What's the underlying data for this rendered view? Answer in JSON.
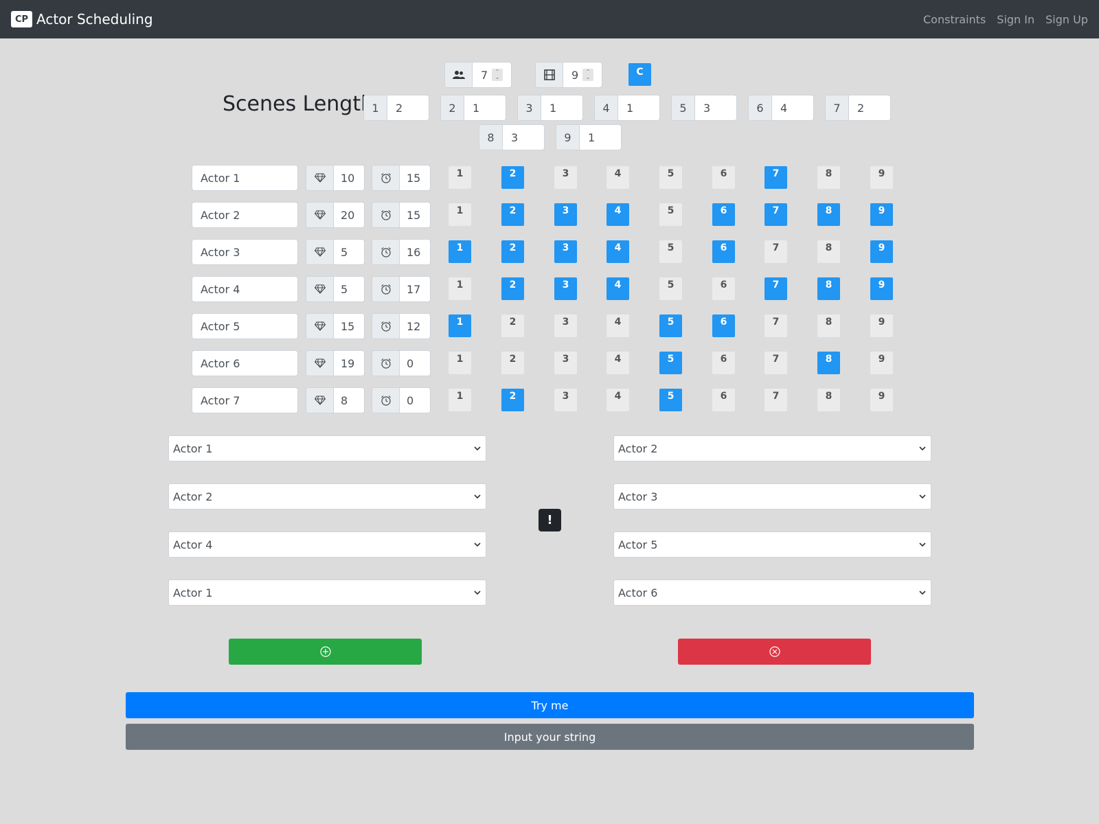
{
  "navbar": {
    "logo_text": "CP",
    "title": "Actor Scheduling",
    "links": [
      "Constraints",
      "Sign In",
      "Sign Up"
    ]
  },
  "counters": {
    "actors": {
      "icon": "people-icon",
      "value": "7"
    },
    "scenes": {
      "icon": "film-icon",
      "value": "9"
    },
    "c_button": "C"
  },
  "scenes_length": {
    "title": "Scenes Length",
    "items": [
      {
        "num": "1",
        "value": "2"
      },
      {
        "num": "2",
        "value": "1"
      },
      {
        "num": "3",
        "value": "1"
      },
      {
        "num": "4",
        "value": "1"
      },
      {
        "num": "5",
        "value": "3"
      },
      {
        "num": "6",
        "value": "4"
      },
      {
        "num": "7",
        "value": "2"
      },
      {
        "num": "8",
        "value": "3"
      },
      {
        "num": "9",
        "value": "1"
      }
    ]
  },
  "actors": [
    {
      "name": "Actor 1",
      "cost": "10",
      "time": "15",
      "scenes": [
        2,
        7
      ]
    },
    {
      "name": "Actor 2",
      "cost": "20",
      "time": "15",
      "scenes": [
        2,
        3,
        4,
        6,
        7,
        8,
        9
      ]
    },
    {
      "name": "Actor 3",
      "cost": "5",
      "time": "16",
      "scenes": [
        1,
        2,
        3,
        4,
        6,
        9
      ]
    },
    {
      "name": "Actor 4",
      "cost": "5",
      "time": "17",
      "scenes": [
        2,
        3,
        4,
        7,
        8,
        9
      ]
    },
    {
      "name": "Actor 5",
      "cost": "15",
      "time": "12",
      "scenes": [
        1,
        5,
        6
      ]
    },
    {
      "name": "Actor 6",
      "cost": "19",
      "time": "0",
      "scenes": [
        5,
        8
      ]
    },
    {
      "name": "Actor 7",
      "cost": "8",
      "time": "0",
      "scenes": [
        2,
        5
      ]
    }
  ],
  "scene_numbers": [
    "1",
    "2",
    "3",
    "4",
    "5",
    "6",
    "7",
    "8",
    "9"
  ],
  "constraints": {
    "left": [
      "Actor 1",
      "Actor 2",
      "Actor 4",
      "Actor 1"
    ],
    "right": [
      "Actor 2",
      "Actor 3",
      "Actor 5",
      "Actor 6"
    ],
    "warning": "!"
  },
  "buttons": {
    "add_icon": "plus-circle-icon",
    "remove_icon": "x-circle-icon",
    "try": "Try me",
    "input": "Input your string"
  },
  "colors": {
    "navbar": "#343a40",
    "accent_blue": "#2196f3",
    "success": "#28a745",
    "danger": "#dc3545",
    "primary": "#007bff",
    "secondary": "#6c757d"
  }
}
